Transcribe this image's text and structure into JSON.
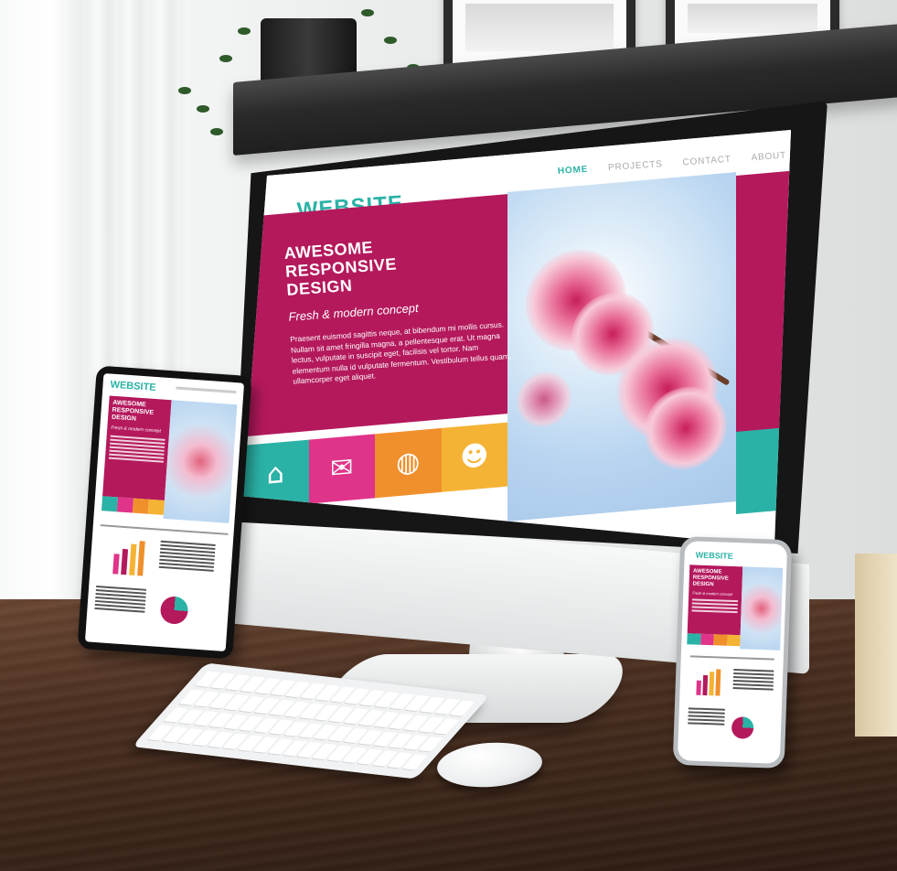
{
  "website": {
    "logo": "WEBSITE",
    "nav": [
      "HOME",
      "PROJECTS",
      "CONTACT",
      "ABOUT"
    ],
    "active_nav": "HOME",
    "hero": {
      "title_lines": [
        "AWESOME",
        "RESPONSIVE",
        "DESIGN"
      ],
      "subtitle": "Fresh & modern concept",
      "body": "Praesent euismod sagittis neque, at bibendum mi mollis cursus. Nullam sit amet fringilla magna, a pellentesque erat. Ut magna lectus, vulputate in suscipit eget, facilisis vel tortor. Nam elementum nulla id vulputate fermentum. Vestibulum tellus quam, ullamcorper eget aliquet."
    },
    "tiles": [
      {
        "icon": "home-icon",
        "glyph": "⌂",
        "color": "#2bb2a6"
      },
      {
        "icon": "mail-icon",
        "glyph": "✉",
        "color": "#e0338a"
      },
      {
        "icon": "globe-icon",
        "glyph": "◍",
        "color": "#f0902c"
      },
      {
        "icon": "user-icon",
        "glyph": "☻",
        "color": "#f5b335"
      }
    ]
  },
  "colors": {
    "brand_teal": "#2bb2a6",
    "brand_magenta": "#b4195c",
    "accent_pink": "#e0338a",
    "accent_orange": "#f0902c",
    "accent_yellow": "#f5b335"
  }
}
